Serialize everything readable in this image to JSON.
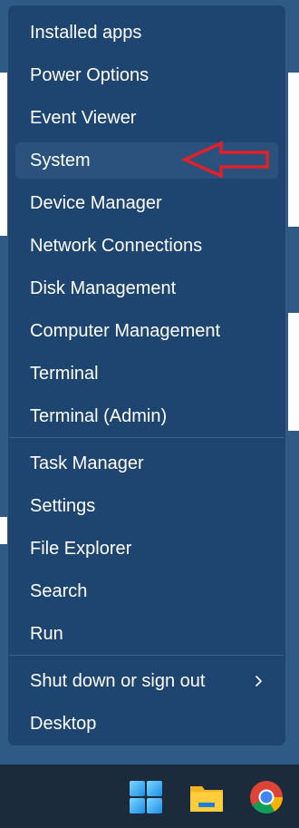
{
  "menu": {
    "items": [
      {
        "label": "Installed apps"
      },
      {
        "label": "Power Options"
      },
      {
        "label": "Event Viewer"
      },
      {
        "label": "System"
      },
      {
        "label": "Device Manager"
      },
      {
        "label": "Network Connections"
      },
      {
        "label": "Disk Management"
      },
      {
        "label": "Computer Management"
      },
      {
        "label": "Terminal"
      },
      {
        "label": "Terminal (Admin)"
      },
      {
        "label": "Task Manager"
      },
      {
        "label": "Settings"
      },
      {
        "label": "File Explorer"
      },
      {
        "label": "Search"
      },
      {
        "label": "Run"
      },
      {
        "label": "Shut down or sign out"
      },
      {
        "label": "Desktop"
      }
    ]
  },
  "annotation": {
    "color": "#e0202a",
    "icon": "red-arrow-pointing-left"
  },
  "taskbar": {
    "icons": [
      {
        "name": "windows-start-icon"
      },
      {
        "name": "file-explorer-icon"
      },
      {
        "name": "chrome-icon"
      }
    ]
  },
  "colors": {
    "menu_bg": "#1e4470",
    "highlight": "#2a527d",
    "taskbar_bg": "#1b2b3b",
    "text": "#ffffff"
  }
}
